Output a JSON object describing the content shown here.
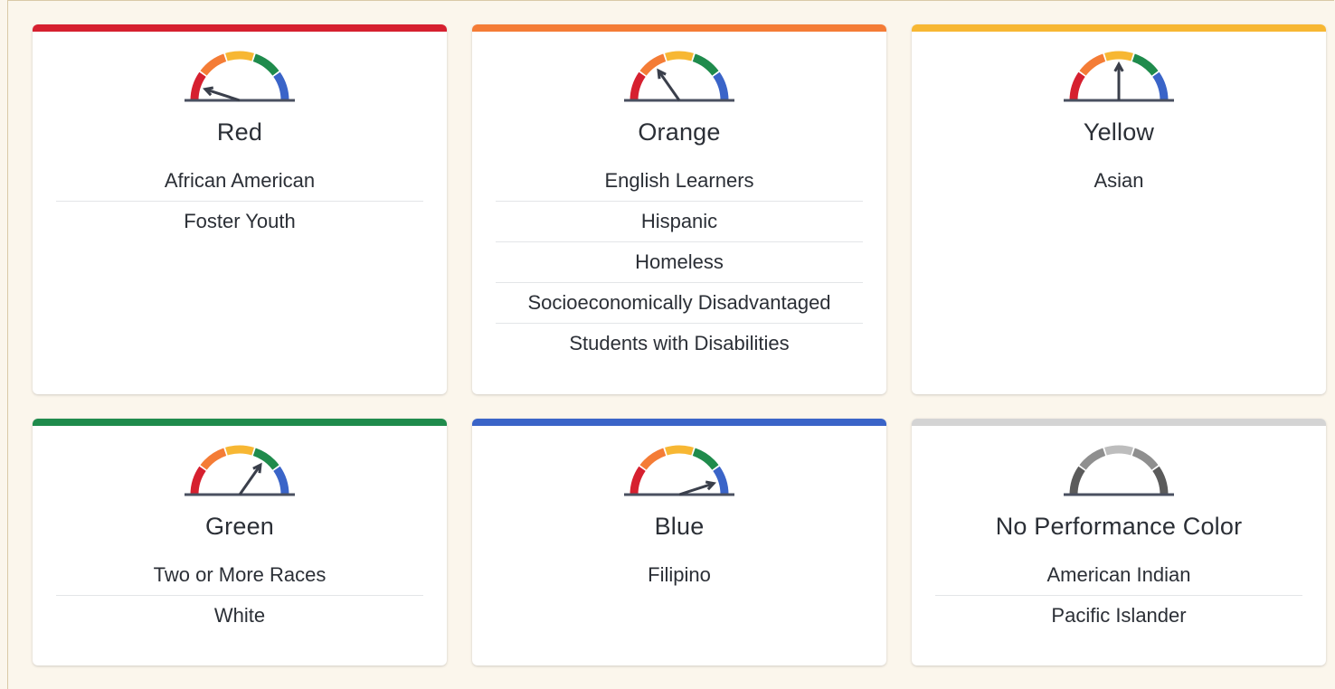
{
  "cards": [
    {
      "title": "Red",
      "level": "red",
      "bar_color": "#d6202f",
      "items": [
        "African American",
        "Foster Youth"
      ]
    },
    {
      "title": "Orange",
      "level": "orange",
      "bar_color": "#f47c36",
      "items": [
        "English Learners",
        "Hispanic",
        "Homeless",
        "Socioeconomically Disadvantaged",
        "Students with Disabilities"
      ]
    },
    {
      "title": "Yellow",
      "level": "yellow",
      "bar_color": "#f7b733",
      "items": [
        "Asian"
      ]
    },
    {
      "title": "Green",
      "level": "green",
      "bar_color": "#1f8b4c",
      "items": [
        "Two or More Races",
        "White"
      ]
    },
    {
      "title": "Blue",
      "level": "blue",
      "bar_color": "#3a64c8",
      "items": [
        "Filipino"
      ]
    },
    {
      "title": "No Performance Color",
      "level": "none",
      "bar_color": "#d4d4d4",
      "items": [
        "American Indian",
        "Pacific Islander"
      ]
    }
  ],
  "gauge_colors": [
    "#d6202f",
    "#f47c36",
    "#f7b733",
    "#1f8b4c",
    "#3a64c8"
  ],
  "gauge_gray_colors": [
    "#5b5b5b",
    "#8f8f8f",
    "#bdbdbd",
    "#8f8f8f",
    "#5b5b5b"
  ]
}
